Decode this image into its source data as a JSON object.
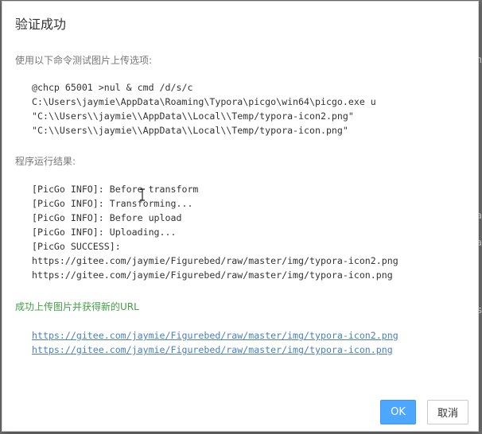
{
  "dialog": {
    "title": "验证成功",
    "command_label": "使用以下命令测试图片上传选项:",
    "command_lines": [
      "@chcp 65001 >nul & cmd /d/s/c",
      "C:\\Users\\jaymie\\AppData\\Roaming\\Typora\\picgo\\win64\\picgo.exe u",
      "\"C:\\\\Users\\\\jaymie\\\\AppData\\\\Local\\\\Temp/typora-icon2.png\"",
      "\"C:\\\\Users\\\\jaymie\\\\AppData\\\\Local\\\\Temp/typora-icon.png\""
    ],
    "result_label": "程序运行结果:",
    "result_lines": [
      "[PicGo INFO]: Before transform",
      "[PicGo INFO]: Transforming...",
      "[PicGo INFO]: Before upload",
      "[PicGo INFO]: Uploading...",
      "[PicGo SUCCESS]:",
      "https://gitee.com/jaymie/Figurebed/raw/master/img/typora-icon2.png",
      "https://gitee.com/jaymie/Figurebed/raw/master/img/typora-icon.png"
    ],
    "success_label": "成功上传图片并获得新的URL",
    "links": [
      "https://gitee.com/jaymie/Figurebed/raw/master/img/typora-icon2.png",
      "https://gitee.com/jaymie/Figurebed/raw/master/img/typora-icon.png"
    ],
    "ok_label": "OK",
    "cancel_label": "取消"
  },
  "background": {
    "edge_chars": [
      "n",
      "a",
      "a",
      "s"
    ]
  },
  "colors": {
    "accent": "#4da6ff",
    "success": "#43a047",
    "link": "#4a7fc0"
  }
}
